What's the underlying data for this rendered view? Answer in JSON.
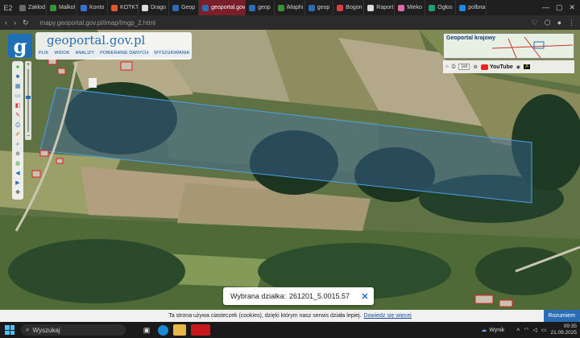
{
  "browser": {
    "pinned": "E2",
    "tabs": [
      {
        "label": "Zakłod",
        "color": "#6a6a6a"
      },
      {
        "label": "Malkol",
        "color": "#3a8f3a"
      },
      {
        "label": "Konto",
        "color": "#3b6fd6"
      },
      {
        "label": "KOTKT",
        "color": "#e4572e"
      },
      {
        "label": "Drago",
        "color": "#dddddd"
      },
      {
        "label": "Geop",
        "color": "#2a6db6"
      },
      {
        "label": "geoportal.gov",
        "color": "#2a6db6",
        "active": true
      },
      {
        "label": "geop",
        "color": "#2a6db6"
      },
      {
        "label": "iMaphi",
        "color": "#3a8f3a"
      },
      {
        "label": "geop",
        "color": "#2a6db6"
      },
      {
        "label": "Bogon",
        "color": "#d93d3d"
      },
      {
        "label": "Raport",
        "color": "#dddddd"
      },
      {
        "label": "Mieko",
        "color": "#e06ab0"
      },
      {
        "label": "Ogłos",
        "color": "#22a06b"
      },
      {
        "label": "polbna",
        "color": "#1e88e5"
      }
    ],
    "url": "mapy.geoportal.gov.pl/imap/Imgp_2.html"
  },
  "map": {
    "brand_name": "geoportal.gov.pl",
    "menu": [
      "PLIK",
      "WIDOK",
      "ANALIZY",
      "POBIERANIE DANYCH",
      "WYSZUKIWANIA"
    ],
    "minimap_title": "Geoportal krajowy",
    "lang": "pol",
    "youtube": "YouTube",
    "zoom_plus": "+",
    "zoom_minus": "−"
  },
  "parcel_popup": {
    "label": "Wybrana działka:",
    "value": "261201_5.0015.57"
  },
  "cookie": {
    "text": "Ta strona używa ciasteczek (cookies), dzięki którym nasz serwis działa lepiej.",
    "link": "Dowiedz się więcej",
    "button": "Rozumiem"
  },
  "taskbar": {
    "search_placeholder": "Wyszukaj",
    "weather": "Wynik",
    "time": "09:35",
    "date": "21.09.2025"
  }
}
